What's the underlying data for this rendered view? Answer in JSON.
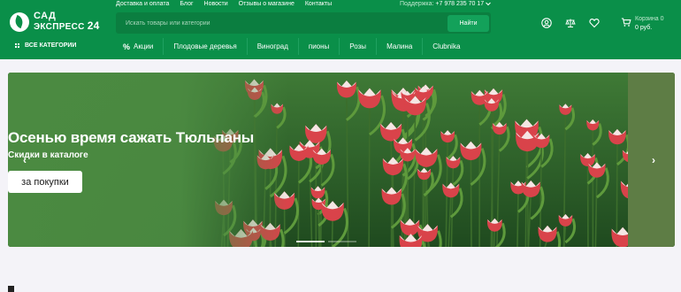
{
  "header": {
    "logo": {
      "line1": "САД",
      "line2": "ЭКСПРЕСС",
      "line2_number": "24"
    },
    "top_links": [
      "Доставка и оплата",
      "Блог",
      "Новости",
      "Отзывы о магазине",
      "Контакты"
    ],
    "support": {
      "label": "Поддержка:",
      "phone": "+7 978 235 70 17"
    },
    "search": {
      "placeholder": "Искать товары или категории",
      "button": "Найти"
    },
    "cart": {
      "count_label": "Корзина 0",
      "total": "0 руб."
    },
    "catalog_button": "ВСЕ КАТЕГОРИИ",
    "nav": [
      "Акции",
      "Плодовые деревья",
      "Виноград",
      "пионы",
      "Розы",
      "Малина",
      "Clubnika"
    ],
    "nav_sale_symbol": "%"
  },
  "banner": {
    "title": "Осенью время сажать Тюльпаны",
    "subtitle": "Скидки в каталоге",
    "cta": "за покупки",
    "prev_arrow": "‹",
    "next_arrow": "›",
    "slides": 2,
    "active_slide": 1
  },
  "colors": {
    "brand_green": "#0a8f49",
    "nav_green": "#0a8f49",
    "search_bg": "#0b7e40",
    "page_bg": "#f4f3f8"
  },
  "icons": [
    "user-icon",
    "compare-scales-icon",
    "heart-icon",
    "cart-icon",
    "grid-icon",
    "percent-icon",
    "chevron-left-icon",
    "chevron-right-icon",
    "chevron-down-icon"
  ]
}
